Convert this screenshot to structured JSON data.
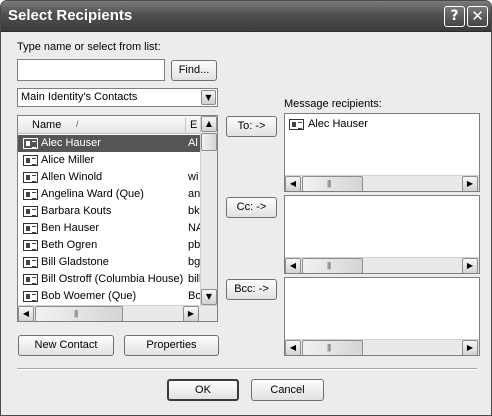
{
  "window": {
    "title": "Select Recipients",
    "help_label": "?",
    "close_label": "✕"
  },
  "search": {
    "label": "Type name or select from list:",
    "value": "",
    "placeholder": "",
    "find_label": "Find..."
  },
  "contact_source": {
    "selected": "Main Identity's Contacts"
  },
  "contact_list": {
    "columns": [
      "Name",
      "E"
    ],
    "sort_indicator": "/",
    "rows": [
      {
        "name": "Alec Hauser",
        "email": "Al"
      },
      {
        "name": "Alice Miller",
        "email": ""
      },
      {
        "name": "Allen Winold",
        "email": "wi"
      },
      {
        "name": "Angelina Ward  (Que)",
        "email": "an"
      },
      {
        "name": "Barbara Kouts",
        "email": "bk"
      },
      {
        "name": "Ben Hauser",
        "email": "NA"
      },
      {
        "name": "Beth Ogren",
        "email": "pb"
      },
      {
        "name": "Bill Gladstone",
        "email": "bg"
      },
      {
        "name": "Bill Ostroff (Columbia House)",
        "email": "bill"
      },
      {
        "name": "Bob Woemer (Que)",
        "email": "Bo"
      }
    ],
    "selected_index": 0
  },
  "buttons": {
    "new_contact": "New Contact",
    "properties": "Properties",
    "to": "To: ->",
    "cc": "Cc: ->",
    "bcc": "Bcc: ->",
    "ok": "OK",
    "cancel": "Cancel"
  },
  "recipients": {
    "label": "Message recipients:",
    "to": [
      "Alec Hauser"
    ],
    "cc": [],
    "bcc": []
  },
  "scroll": {
    "grip": "|||"
  },
  "icons": {
    "combo_arrow": "▼",
    "up_arrow": "▲",
    "down_arrow": "▼",
    "left_arrow": "◀",
    "right_arrow": "▶",
    "contact": "contact-card-icon"
  }
}
